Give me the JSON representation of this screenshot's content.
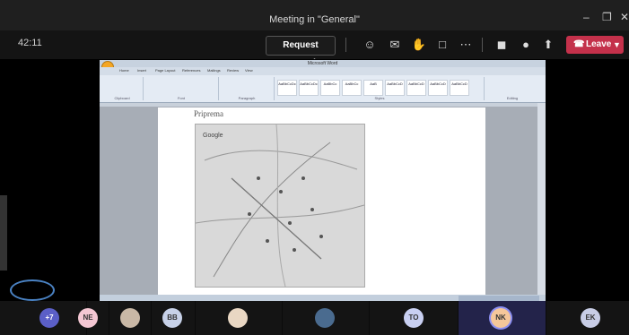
{
  "window": {
    "title": "Meeting in \"General\""
  },
  "toolbar": {
    "timer": "42:11",
    "request_control": "Request control",
    "leave": "Leave"
  },
  "shared_screen": {
    "app_title": "Microsoft Word",
    "ribbon_tabs": [
      "Home",
      "Insert",
      "Page Layout",
      "References",
      "Mailings",
      "Review",
      "View"
    ],
    "ribbon_groups": [
      "Clipboard",
      "Font",
      "Paragraph",
      "Styles",
      "Editing"
    ],
    "style_samples": [
      "AaBbCcDc",
      "AaBbCcDc",
      "AaBbCc",
      "AaBbCc",
      "AaB",
      "AaBbCcD",
      "AaBbCcD",
      "AaBbCcD",
      "AaBbCcD"
    ],
    "document_heading": "Priprema",
    "map_label": "Google"
  },
  "participants": [
    {
      "initials": "+7",
      "color": "#5b5fc7"
    },
    {
      "initials": "NE",
      "color": "#f4c7d3"
    },
    {
      "initials": "",
      "color": "#c9b8a6"
    },
    {
      "initials": "BB",
      "color": "#c7d1e8"
    },
    {
      "initials": "",
      "color": "#e9d7c3"
    },
    {
      "initials": "",
      "color": "#4a6b8f"
    },
    {
      "initials": "TO",
      "color": "#c9d0f2"
    },
    {
      "initials": "NK",
      "color": "#f5c79a"
    },
    {
      "initials": "EK",
      "color": "#c8cde6"
    }
  ]
}
